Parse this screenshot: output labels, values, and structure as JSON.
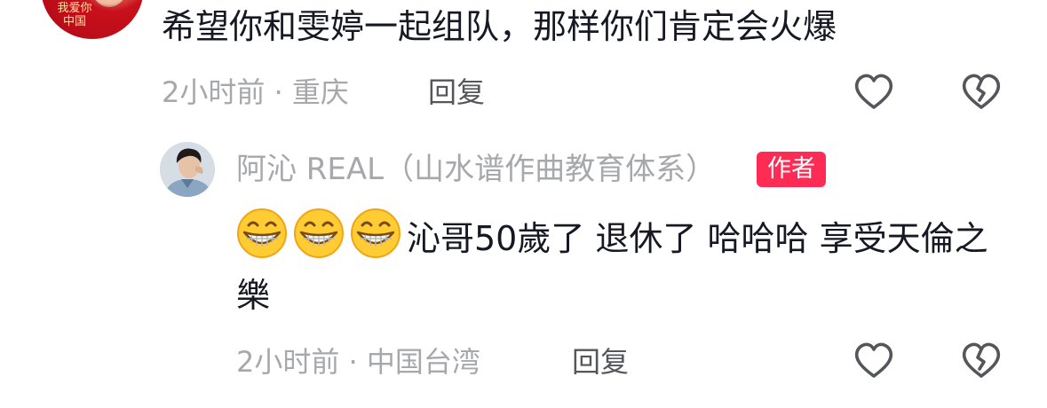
{
  "comment": {
    "text": "希望你和雯婷一起组队，那样你们肯定会火爆",
    "meta": "2小时前 · 重庆",
    "reply_label": "回复",
    "avatar_seal_text": "我爱你中国"
  },
  "reply": {
    "author": "阿沁 REAL（山水谱作曲教育体系）",
    "author_badge": "作者",
    "emoji": [
      "grin-emoji",
      "grin-emoji",
      "grin-emoji"
    ],
    "text": "沁哥50歲了 退休了 哈哈哈 享受天倫之樂",
    "meta": "2小时前 · 中国台湾",
    "reply_label": "回复"
  },
  "icons": {
    "like": "heart-outline-icon",
    "dislike": "broken-heart-icon"
  },
  "colors": {
    "badge": "#fe2c55",
    "meta_text": "#a7a8ac",
    "body_text": "#161823",
    "icon_stroke": "#55565c"
  }
}
